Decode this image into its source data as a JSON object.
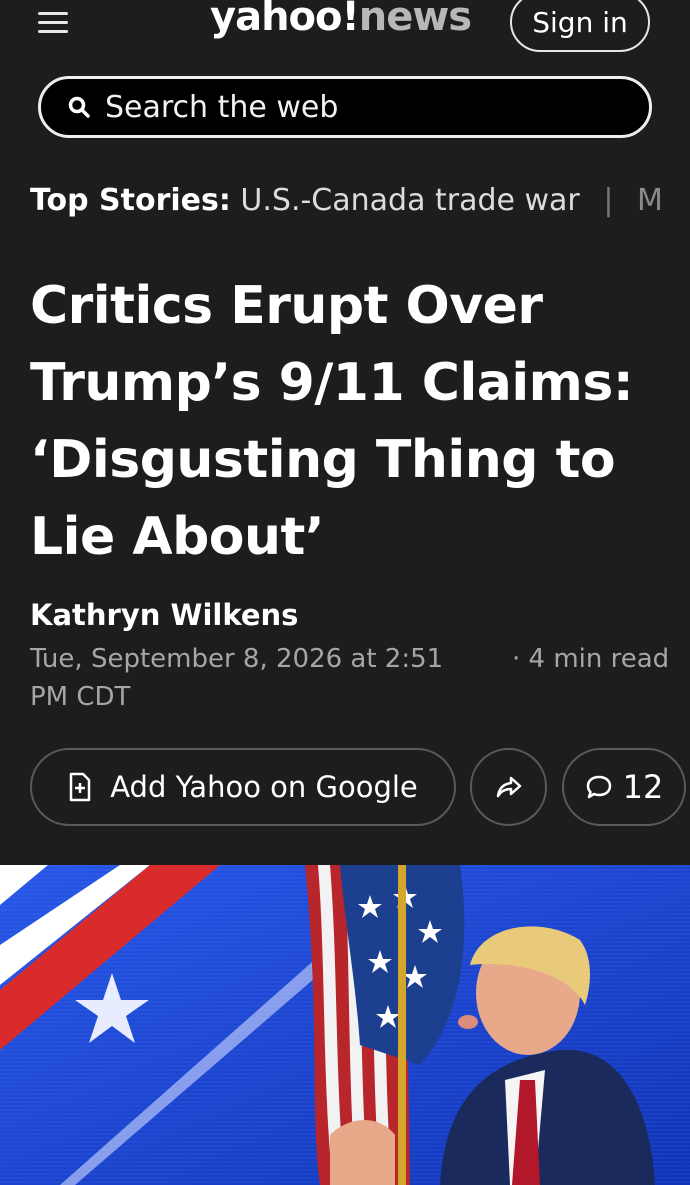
{
  "header": {
    "menu_icon": "hamburger-menu-icon",
    "logo_yahoo": "yahoo!",
    "logo_news": "news",
    "sign_in_label": "Sign in"
  },
  "search": {
    "icon": "search-icon",
    "placeholder": "Search the web"
  },
  "top_stories": {
    "label": "Top Stories:",
    "items": [
      "U.S.-Canada trade war",
      "Mian"
    ]
  },
  "article": {
    "headline": "Critics Erupt Over Trump’s 9/11 Claims: ‘Disgusting Thing to Lie About’",
    "author": "Kathryn Wilkens",
    "date": "Tue, September 8, 2026 at 2:51 PM CDT",
    "read_time": "· 4 min read"
  },
  "actions": {
    "add_google_label": "Add Yahoo on Google",
    "add_google_icon": "add-document-icon",
    "share_icon": "share-arrow-icon",
    "comment_icon": "comment-bubble-icon",
    "comment_count": "12"
  },
  "colors": {
    "background": "#1d1d1d",
    "text": "#ffffff",
    "muted": "#a6a6a6",
    "border": "#5a5a5a"
  }
}
